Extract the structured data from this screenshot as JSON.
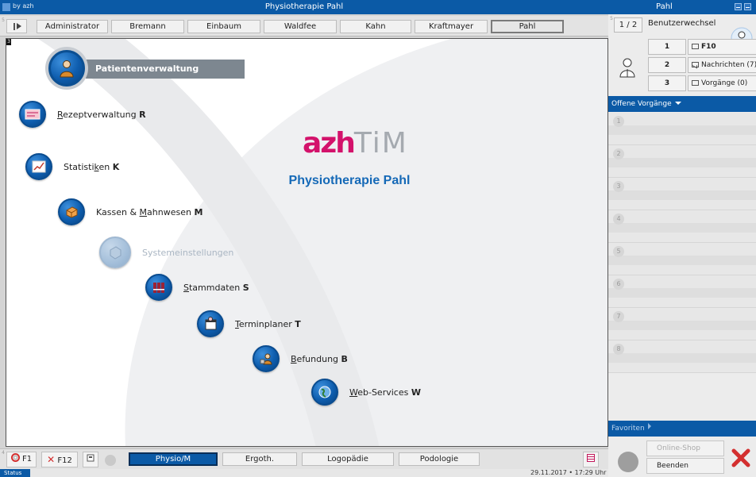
{
  "app": {
    "brand_text": "by azh",
    "window_title": "Physiotherapie Pahl",
    "current_user_title": "Pahl"
  },
  "users": {
    "tabs": [
      "Administrator",
      "Bremann",
      "Einbaum",
      "Waldfee",
      "Kahn",
      "Kraftmayer",
      "Pahl"
    ],
    "active": "Pahl"
  },
  "main": {
    "logo_prefix": "azh",
    "logo_suffix": "TiM",
    "practice_name": "Physiotherapie Pahl",
    "active_module": "Patientenverwaltung",
    "menu": [
      {
        "id": "rezept",
        "pre": "",
        "ul": "R",
        "post": "ezeptverwaltung",
        "key": "R",
        "icon": "prescription-icon",
        "enabled": true
      },
      {
        "id": "statistik",
        "pre": "Statisti",
        "ul": "k",
        "post": "en",
        "key": "K",
        "icon": "statistics-icon",
        "enabled": true
      },
      {
        "id": "kassen",
        "pre": "Kassen & ",
        "ul": "M",
        "post": "ahnwesen",
        "key": "M",
        "icon": "cashbox-icon",
        "enabled": true
      },
      {
        "id": "system",
        "pre": "Systemeinstellungen",
        "ul": "",
        "post": "",
        "key": "",
        "icon": "settings-cube-icon",
        "enabled": false
      },
      {
        "id": "stamm",
        "pre": "",
        "ul": "S",
        "post": "tammdaten",
        "key": "S",
        "icon": "binders-icon",
        "enabled": true
      },
      {
        "id": "termin",
        "pre": "",
        "ul": "T",
        "post": "erminplaner",
        "key": "T",
        "icon": "calendar-icon",
        "enabled": true
      },
      {
        "id": "befund",
        "pre": "",
        "ul": "B",
        "post": "efundung",
        "key": "B",
        "icon": "finding-icon",
        "enabled": true
      },
      {
        "id": "web",
        "pre": "",
        "ul": "W",
        "post": "eb-Services",
        "key": "W",
        "icon": "globe-icon",
        "enabled": true
      }
    ]
  },
  "bottom": {
    "help_label": "F1",
    "close_label": "F12",
    "modules": [
      "Physio/M",
      "Ergoth.",
      "Logopädie",
      "Podologie"
    ],
    "active_module": "Physio/M",
    "status_label": "Status",
    "datetime": "29.11.2017 • 17:29 Uhr"
  },
  "right": {
    "pager": "1 / 2",
    "switch_user": "Benutzerwechsel",
    "rows": [
      {
        "num": "1",
        "label": "F10",
        "icon": "list-icon"
      },
      {
        "num": "2",
        "label": "Nachrichten (7)",
        "icon": "envelope-icon"
      },
      {
        "num": "3",
        "label": "Vorgänge (0)",
        "icon": "window-icon"
      }
    ],
    "open_tasks_title": "Offene Vorgänge",
    "slots": [
      "1",
      "2",
      "3",
      "4",
      "5",
      "6",
      "7",
      "8"
    ],
    "favorites_title": "Favoriten",
    "online_shop": "Online-Shop",
    "quit": "Beenden"
  }
}
